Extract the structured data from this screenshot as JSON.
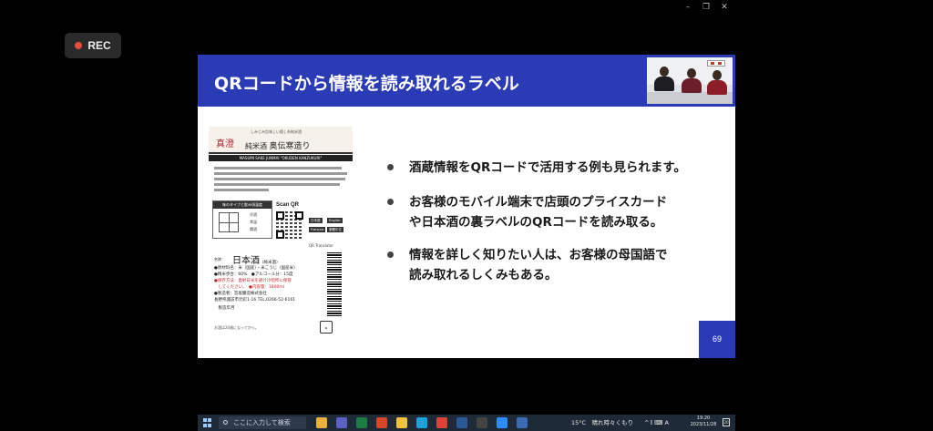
{
  "recording": {
    "label": "REC"
  },
  "window_controls": {
    "minimize": "–",
    "restore": "❐",
    "close": "✕"
  },
  "slide": {
    "title": "QRコードから情報を読み取れるラベル",
    "page_number": "69",
    "header_color": "#2a3bb5",
    "bullets": [
      {
        "lines": [
          "酒蔵情報をQRコードで活用する例も見られます。"
        ]
      },
      {
        "lines": [
          "お客様のモバイル端末で店頭のプライスカード",
          "や日本酒の裏ラベルのQRコードを読み取る。"
        ]
      },
      {
        "lines": [
          "情報を詳しく知りたい人は、お客様の母国語で",
          "読み取れるしくみもある。"
        ]
      }
    ],
    "label_image": {
      "tagline": "しみじみ旨味しい癒し系純米酒",
      "brand_red": "真澄",
      "brand_type": "純米酒",
      "brand_name": "奥伝寒造り",
      "strip": "MASUMI SAKE JUNMAI \"OKUDEN KANZUKURI\"",
      "taste_title": "味のタイプと飲み頃温度",
      "taste_options": [
        "冷酒",
        "常温",
        "燗酒"
      ],
      "scan_qr": "Scan QR",
      "languages": [
        "日本語",
        "English",
        "Français",
        "繁體中文"
      ],
      "qr_translator": "QR Translator",
      "name_label": "名称：",
      "name_value": "日本酒",
      "name_suffix": "（純米酒）",
      "rows": [
        "●原材料名：米（国産）・米こうじ（国産米）",
        "●精米歩合：60%　●アルコール分：15度",
        "●保存方法：直射日光を避け冷暗所に保管",
        "　してください。　●内容量：1800ml",
        "●製造者：宮坂醸造株式会社",
        "長野県諏訪市元町1-16 TEL.0266-52-6161",
        "　製造年月",
        "お酒は20歳になってから。"
      ]
    }
  },
  "taskbar": {
    "search_placeholder": "ここに入力して検索",
    "weather": "15°C　晴れ時々くもり",
    "tray": "^ 𝄃 ⌨ A",
    "time": "19:20",
    "date": "2023/11/28",
    "notif": "20",
    "apps": [
      {
        "name": "file-explorer",
        "color": "#e8b33c"
      },
      {
        "name": "teams",
        "color": "#5b62c4"
      },
      {
        "name": "excel",
        "color": "#1e7b45"
      },
      {
        "name": "powerpoint",
        "color": "#d24726"
      },
      {
        "name": "notes",
        "color": "#f0c23b"
      },
      {
        "name": "edge",
        "color": "#1fa0d8"
      },
      {
        "name": "chrome",
        "color": "#db4437"
      },
      {
        "name": "word",
        "color": "#2b5797"
      },
      {
        "name": "media",
        "color": "#444"
      },
      {
        "name": "zoom",
        "color": "#2d8cff"
      },
      {
        "name": "app",
        "color": "#3d6bb3"
      }
    ]
  }
}
